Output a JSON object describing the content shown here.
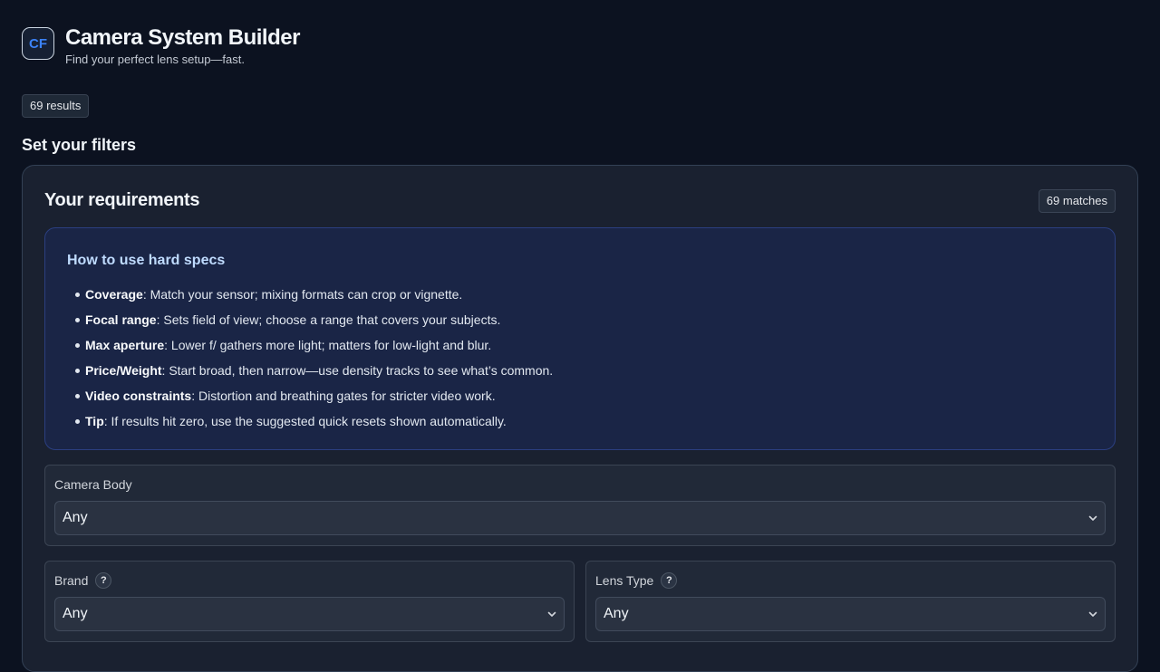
{
  "app": {
    "logo": "CF",
    "title": "Camera System Builder",
    "subtitle": "Find your perfect lens setup—fast."
  },
  "results_badge": "69 results",
  "section_title": "Set your filters",
  "card": {
    "title": "Your requirements",
    "matches_badge": "69 matches"
  },
  "help": {
    "title": "How to use hard specs",
    "items": [
      {
        "term": "Coverage",
        "text": ": Match your sensor; mixing formats can crop or vignette."
      },
      {
        "term": "Focal range",
        "text": ": Sets field of view; choose a range that covers your subjects."
      },
      {
        "term": "Max aperture",
        "text": ": Lower f/ gathers more light; matters for low-light and blur."
      },
      {
        "term": "Price/Weight",
        "text": ": Start broad, then narrow—use density tracks to see what’s common."
      },
      {
        "term": "Video constraints",
        "text": ": Distortion and breathing gates for stricter video work."
      },
      {
        "term": "Tip",
        "text": ": If results hit zero, use the suggested quick resets shown automatically."
      }
    ]
  },
  "filters": {
    "camera_body": {
      "label": "Camera Body",
      "value": "Any"
    },
    "brand": {
      "label": "Brand",
      "help": "?",
      "value": "Any"
    },
    "lens_type": {
      "label": "Lens Type",
      "help": "?",
      "value": "Any"
    }
  },
  "icons": {
    "dropdown": "chevron-down-icon",
    "help": "help-icon"
  }
}
